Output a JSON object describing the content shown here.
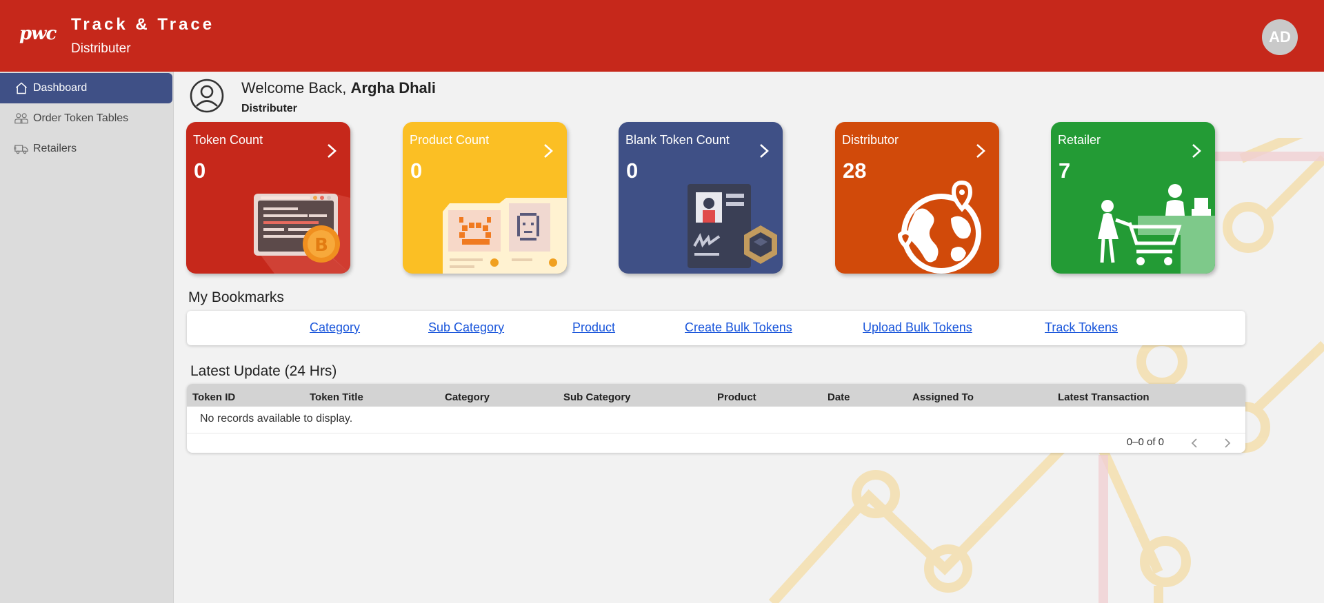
{
  "header": {
    "logo": "pwc",
    "title": "Track & Trace",
    "subtitle": "Distributer",
    "avatar_initials": "AD",
    "bg_color": "#c6281b"
  },
  "sidebar": {
    "items": [
      {
        "label": "Dashboard",
        "icon": "home-icon",
        "active": true
      },
      {
        "label": "Order Token Tables",
        "icon": "users-icon",
        "active": false
      },
      {
        "label": "Retailers",
        "icon": "truck-icon",
        "active": false
      }
    ],
    "active_color": "#3f5086"
  },
  "welcome": {
    "prefix": "Welcome Back, ",
    "name": "Argha Dhali",
    "role": "Distributer"
  },
  "cards": [
    {
      "title": "Token Count",
      "value": "0",
      "color": "#c6281b",
      "icon": "bitcoin-browser-icon"
    },
    {
      "title": "Product Count",
      "value": "0",
      "color": "#fbbf24",
      "icon": "product-folder-icon"
    },
    {
      "title": "Blank Token Count",
      "value": "0",
      "color": "#3f5086",
      "icon": "id-card-token-icon"
    },
    {
      "title": "Distributor",
      "value": "28",
      "color": "#d14a0a",
      "icon": "globe-location-icon"
    },
    {
      "title": "Retailer",
      "value": "7",
      "color": "#239b35",
      "icon": "shop-cart-icon"
    }
  ],
  "bookmarks": {
    "title": "My Bookmarks",
    "links": [
      "Category",
      "Sub Category",
      "Product",
      "Create Bulk Tokens",
      "Upload Bulk Tokens",
      "Track Tokens"
    ]
  },
  "latest": {
    "title": "Latest Update (24 Hrs)",
    "columns": [
      "Token ID",
      "Token Title",
      "Category",
      "Sub Category",
      "Product",
      "Date",
      "Assigned To",
      "Latest Transaction"
    ],
    "empty_message": "No records available to display.",
    "pagination": "0–0 of 0"
  }
}
